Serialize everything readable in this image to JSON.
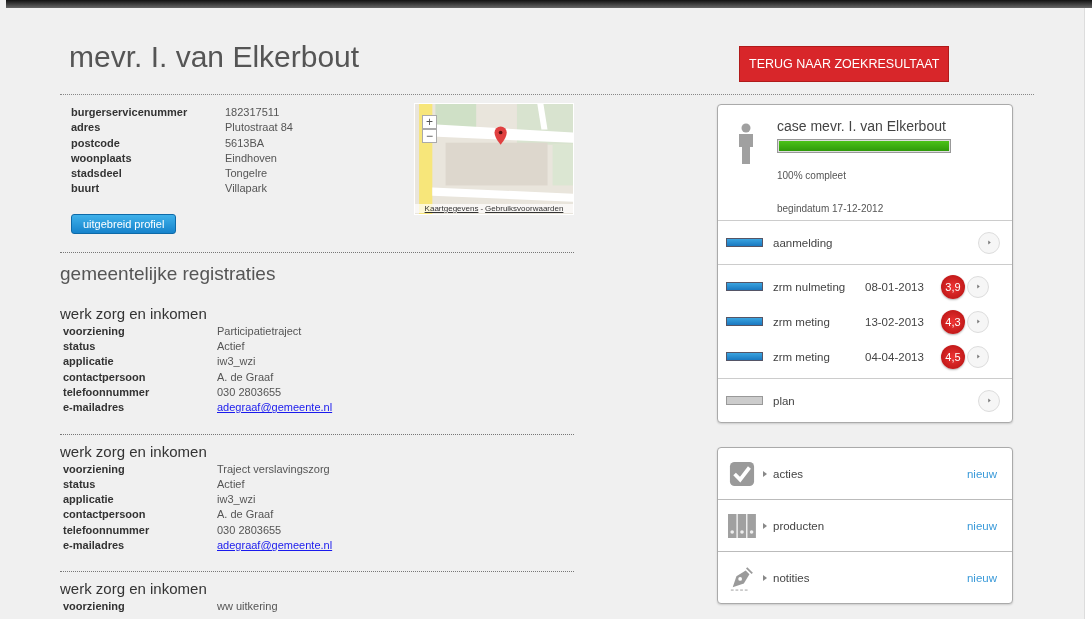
{
  "title": "mevr. I. van Elkerbout",
  "back_button": "TERUG NAAR ZOEKRESULTAAT",
  "profile": [
    {
      "label": "burgerservicenummer",
      "value": "182317511"
    },
    {
      "label": "adres",
      "value": "Plutostraat 84"
    },
    {
      "label": "postcode",
      "value": "5613BA"
    },
    {
      "label": "woonplaats",
      "value": "Eindhoven"
    },
    {
      "label": "stadsdeel",
      "value": "Tongelre"
    },
    {
      "label": "buurt",
      "value": "Villapark"
    }
  ],
  "map": {
    "kind": "picture",
    "links": [
      "Kaartgegevens",
      "Gebruiksvoorwaarden"
    ],
    "separator": "-",
    "zoom_in": "+",
    "zoom_out": "−"
  },
  "profile_button": "uitgebreid profiel",
  "registrations_title": "gemeentelijke registraties",
  "registrations": [
    {
      "title": "werk zorg en inkomen",
      "fields": [
        {
          "label": "voorziening",
          "value": "Participatietraject",
          "kind": "text"
        },
        {
          "label": "status",
          "value": "Actief",
          "kind": "text"
        },
        {
          "label": "applicatie",
          "value": "iw3_wzi",
          "kind": "text"
        },
        {
          "label": "contactpersoon",
          "value": "A. de Graaf",
          "kind": "text"
        },
        {
          "label": "telefoonnummer",
          "value": "030 2803655",
          "kind": "text"
        },
        {
          "label": "e-mailadres",
          "value": "adegraaf@gemeente.nl",
          "kind": "link"
        }
      ]
    },
    {
      "title": "werk zorg en inkomen",
      "fields": [
        {
          "label": "voorziening",
          "value": "Traject verslavingszorg",
          "kind": "text"
        },
        {
          "label": "status",
          "value": "Actief",
          "kind": "text"
        },
        {
          "label": "applicatie",
          "value": "iw3_wzi",
          "kind": "text"
        },
        {
          "label": "contactpersoon",
          "value": "A. de Graaf",
          "kind": "text"
        },
        {
          "label": "telefoonnummer",
          "value": "030 2803655",
          "kind": "text"
        },
        {
          "label": "e-mailadres",
          "value": "adegraaf@gemeente.nl",
          "kind": "link"
        }
      ]
    },
    {
      "title": "werk zorg en inkomen",
      "fields": [
        {
          "label": "voorziening",
          "value": "ww uitkering",
          "kind": "text"
        }
      ]
    }
  ],
  "case": {
    "title": "case mevr. I. van Elkerbout",
    "level": 1,
    "progress_text": "100% compleet",
    "start": "begindatum 17-12-2012"
  },
  "step_groups": [
    {
      "steps": [
        {
          "name": "aanmelding",
          "done": true
        }
      ]
    },
    {
      "steps": [
        {
          "name": "zrm nulmeting",
          "done": true,
          "date": "08-01-2013",
          "score": "3,9"
        },
        {
          "name": "zrm meting",
          "done": true,
          "date": "13-02-2013",
          "score": "4,3"
        },
        {
          "name": "zrm meting",
          "done": true,
          "date": "04-04-2013",
          "score": "4,5"
        }
      ]
    },
    {
      "steps": [
        {
          "name": "plan",
          "done": false
        }
      ]
    }
  ],
  "actions": [
    {
      "kind": "check",
      "label": "acties",
      "link": "nieuw"
    },
    {
      "kind": "binders",
      "label": "producten",
      "link": "nieuw"
    },
    {
      "kind": "pen",
      "label": "notities",
      "link": "nieuw"
    }
  ]
}
